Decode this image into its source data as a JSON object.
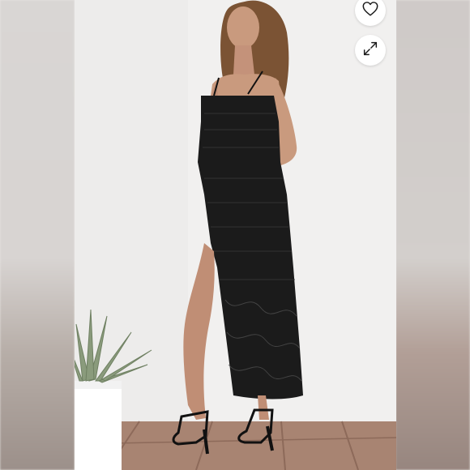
{
  "viewer": {
    "photo_subject": "",
    "accent_color": "#1a1a1a"
  },
  "controls": {
    "like_icon": "heart-icon",
    "expand_icon": "expand-icon"
  }
}
